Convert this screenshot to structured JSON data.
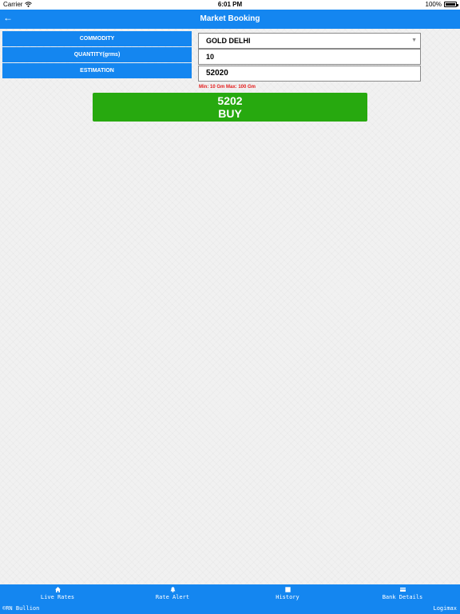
{
  "status_bar": {
    "carrier": "Carrier",
    "time": "6:01 PM",
    "battery": "100%"
  },
  "nav": {
    "back_icon": "back-arrow-icon",
    "title": "Market Booking"
  },
  "form": {
    "commodity_label": "COMMODITY",
    "quantity_label": "QUANTITY(grms)",
    "estimation_label": "ESTIMATION",
    "commodity_value": "GOLD DELHI",
    "quantity_value": "10",
    "estimation_value": "52020",
    "hint": "Min: 10 Gm Max: 100 Gm"
  },
  "buy": {
    "price": "5202",
    "label": "BUY"
  },
  "tabs": [
    {
      "label": "Live Rates",
      "icon": "home-icon"
    },
    {
      "label": "Rate Alert",
      "icon": "bell-icon"
    },
    {
      "label": "History",
      "icon": "history-icon"
    },
    {
      "label": "Bank Details",
      "icon": "card-icon"
    }
  ],
  "footer": {
    "left": "©RN Bullion",
    "right": "Logimax"
  },
  "colors": {
    "primary": "#1486f0",
    "buy": "#27a90f",
    "hint": "#e41a1a"
  }
}
